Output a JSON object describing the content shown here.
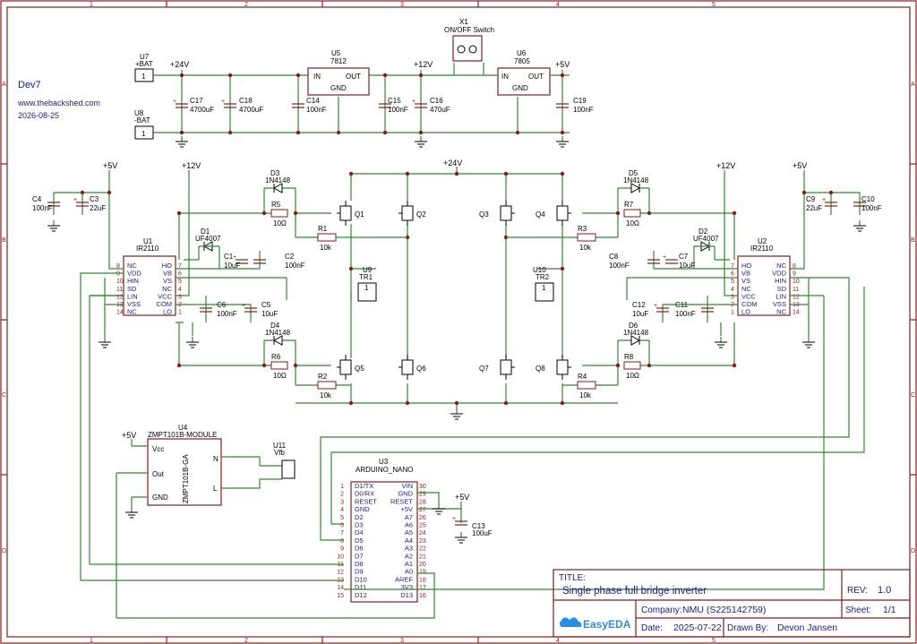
{
  "header": {
    "name": "Dev7",
    "url": "www.thebackshed.com",
    "date": "2026-08-25"
  },
  "border": {
    "cols": [
      "1",
      "2",
      "3",
      "4",
      "5"
    ],
    "rows": [
      "A",
      "B",
      "C",
      "D"
    ]
  },
  "title_block": {
    "title_label": "TITLE:",
    "title": "Single phase full bridge inverter",
    "rev_label": "REV:",
    "rev": "1.0",
    "company_label": "Company:",
    "company": "NMU (S225142759)",
    "sheet_label": "Sheet:",
    "sheet": "1/1",
    "date_label": "Date:",
    "date": "2025-07-22",
    "drawn_label": "Drawn By:",
    "drawn": "Devon Jansen",
    "logo": "EasyEDA"
  },
  "nets": {
    "p24": "+24V",
    "p12": "+12V",
    "p5": "+5V"
  },
  "labels": {
    "u7": "U7",
    "bat_pos": "+BAT",
    "u8": "U8",
    "bat_neg": "-BAT",
    "u5": "U5",
    "u5v": "7812",
    "u6": "U6",
    "u6v": "7805",
    "x1": "X1",
    "x1v": "ON/OFF Switch",
    "in": "IN",
    "out": "OUT",
    "gnd": "GND",
    "c17": "C17",
    "c17v": "4700uF",
    "c18": "C18",
    "c18v": "4700uF",
    "c14": "C14",
    "c14v": "100nF",
    "c15": "C15",
    "c15v": "100nF",
    "c16": "C16",
    "c16v": "470uF",
    "c19": "C19",
    "c19v": "100nF",
    "c4": "C4",
    "c4v": "100nF",
    "c3": "C3",
    "c3v": "22uF",
    "c9": "C9",
    "c9v": "22uF",
    "c10": "C10",
    "c10v": "100nF",
    "u1": "U1",
    "u2": "U2",
    "ir": "IR2110",
    "d3": "D3",
    "d4": "D4",
    "d5": "D5",
    "d6": "D6",
    "d1n": "1N4148",
    "d1": "D1",
    "d2": "D2",
    "uf": "UF4007",
    "r5": "R5",
    "r6": "R6",
    "r7": "R7",
    "r8": "R8",
    "r10": "10Ω",
    "r1": "R1",
    "r2": "R2",
    "r3": "R3",
    "r4": "R4",
    "r10k": "10k",
    "q1": "Q1",
    "q2": "Q2",
    "q3": "Q3",
    "q4": "Q4",
    "q5": "Q5",
    "q6": "Q6",
    "q7": "Q7",
    "q8": "Q8",
    "c1": "C1",
    "c1v": "10uF",
    "c2": "C2",
    "c2v": "100nF",
    "c6": "C6",
    "c6v": "100nF",
    "c5": "C5",
    "c5v": "10uF",
    "c8": "C8",
    "c8v": "100nF",
    "c7": "C7",
    "c7v": "10uF",
    "c12": "C12",
    "c12v": "10uF",
    "c11": "C11",
    "c11v": "100nF",
    "u9": "U9",
    "tr1": "TR1",
    "u10": "U10",
    "tr2": "TR2",
    "one": "1",
    "u4": "U4",
    "zm": "ZMPT101B-MODULE",
    "zmb": "ZMPT101B-GA",
    "vcc": "Vcc",
    "outp": "Out",
    "gndp": "GND",
    "np": "N",
    "lp": "L",
    "u11": "U11",
    "vfb": "Vfb",
    "u3": "U3",
    "nano": "ARDUINO_NANO",
    "c13": "C13",
    "c13v": "100uF"
  },
  "ir_pins_left": [
    [
      "8",
      "NC"
    ],
    [
      "9",
      "VDD"
    ],
    [
      "10",
      "HIN"
    ],
    [
      "11",
      "SD"
    ],
    [
      "12",
      "LIN"
    ],
    [
      "13",
      "VSS"
    ],
    [
      "14",
      "NC"
    ]
  ],
  "ir_pins_right": [
    [
      "7",
      "HO"
    ],
    [
      "6",
      "VB"
    ],
    [
      "5",
      "VS"
    ],
    [
      "4",
      "NC"
    ],
    [
      "3",
      "VCC"
    ],
    [
      "2",
      "COM"
    ],
    [
      "1",
      "LO"
    ]
  ],
  "nano_left": [
    [
      "1",
      "D1/TX"
    ],
    [
      "2",
      "D0/RX"
    ],
    [
      "3",
      "RESET"
    ],
    [
      "4",
      "GND"
    ],
    [
      "5",
      "D2"
    ],
    [
      "6",
      "D3"
    ],
    [
      "7",
      "D4"
    ],
    [
      "8",
      "D5"
    ],
    [
      "9",
      "D6"
    ],
    [
      "10",
      "D7"
    ],
    [
      "11",
      "D8"
    ],
    [
      "12",
      "D9"
    ],
    [
      "13",
      "D10"
    ],
    [
      "14",
      "D11"
    ],
    [
      "15",
      "D12"
    ]
  ],
  "nano_right": [
    [
      "30",
      "VIN"
    ],
    [
      "29",
      "GND"
    ],
    [
      "28",
      "RESET"
    ],
    [
      "27",
      "+5V"
    ],
    [
      "26",
      "A7"
    ],
    [
      "25",
      "A6"
    ],
    [
      "24",
      "A5"
    ],
    [
      "23",
      "A4"
    ],
    [
      "22",
      "A3"
    ],
    [
      "21",
      "A2"
    ],
    [
      "20",
      "A1"
    ],
    [
      "19",
      "A0"
    ],
    [
      "18",
      "AREF"
    ],
    [
      "17",
      "3V3"
    ],
    [
      "16",
      "D13"
    ]
  ]
}
